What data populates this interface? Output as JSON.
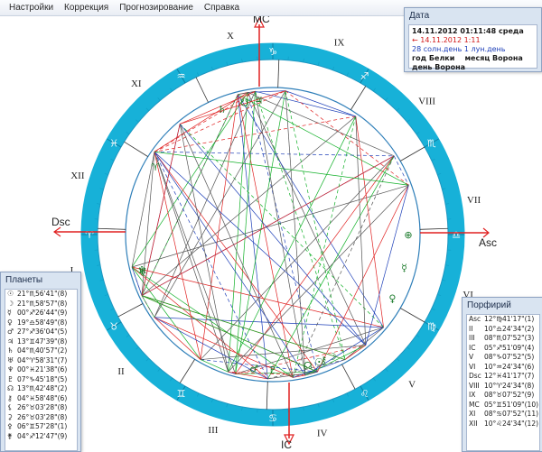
{
  "menu": [
    "Настройки",
    "Коррекция",
    "Прогнозирование",
    "Справка"
  ],
  "chart": {
    "angles": {
      "mc": "MC",
      "ic": "IC",
      "asc": "Asc",
      "dsc": "Dsc"
    },
    "house_numerals": [
      "I",
      "II",
      "III",
      "IV",
      "V",
      "VI",
      "VII",
      "VIII",
      "IX",
      "X",
      "XI",
      "XII"
    ],
    "colors": {
      "ring": "#17b1d8",
      "axis": "#e02020",
      "inner_ring": "#2f7fb9",
      "aspect_green": "#11b028",
      "aspect_red": "#e02020",
      "aspect_blue": "#1d3fb8",
      "aspect_gray": "#555555"
    }
  },
  "date_panel": {
    "title": "Дата",
    "line1": "14.11.2012  01:11:48  среда",
    "line2": "← 14.11.2012  1:11",
    "line3": "28 солн.день 1 лун.день",
    "line4a": "год Белки",
    "line4b": "месяц Ворона",
    "line5": "день Ворона"
  },
  "planets_panel": {
    "title": "Планеты",
    "rows": [
      {
        "glyph": "☉",
        "value": "21°♏56'41\"(8)"
      },
      {
        "glyph": "☽",
        "value": "21°♏58'57\"(8)"
      },
      {
        "glyph": "☿",
        "value": "00°♐26'44\"(9)"
      },
      {
        "glyph": "♀",
        "value": "19°♎58'49\"(8)"
      },
      {
        "glyph": "♂",
        "value": "27°♐36'04\"(5)"
      },
      {
        "glyph": "♃",
        "value": "13°♊47'39\"(8)"
      },
      {
        "glyph": "♄",
        "value": "04°♏40'57\"(2)"
      },
      {
        "glyph": "♅",
        "value": "04°♈58'31\"(7)"
      },
      {
        "glyph": "♆",
        "value": "00°♓21'38\"(6)"
      },
      {
        "glyph": "♇",
        "value": "07°♑45'18\"(5)"
      },
      {
        "glyph": "☊",
        "value": "13°♏42'48\"(2)"
      },
      {
        "glyph": "⚷",
        "value": "04°♓58'48\"(6)"
      },
      {
        "glyph": "⚸",
        "value": "26°♉03'28\"(8)"
      },
      {
        "glyph": "⚳",
        "value": "26°♉03'28\"(8)"
      },
      {
        "glyph": "⚴",
        "value": "06°♊57'28\"(1)"
      },
      {
        "glyph": "⚵",
        "value": "04°♐12'47\"(9)"
      }
    ]
  },
  "houses_panel": {
    "title": "Порфирий",
    "rows": [
      {
        "name": "Asc",
        "value": "12°♍41'17\"(1)"
      },
      {
        "name": "II",
        "value": "10°♎24'34\"(2)"
      },
      {
        "name": "III",
        "value": "08°♏07'52\"(3)"
      },
      {
        "name": "IC",
        "value": "05°♐51'09\"(4)"
      },
      {
        "name": "V",
        "value": "08°♑07'52\"(5)"
      },
      {
        "name": "VI",
        "value": "10°♒24'34\"(6)"
      },
      {
        "name": "Dsc",
        "value": "12°♓41'17\"(7)"
      },
      {
        "name": "VIII",
        "value": "10°♈24'34\"(8)"
      },
      {
        "name": "IX",
        "value": "08°♉07'52\"(9)"
      },
      {
        "name": "MC",
        "value": "05°♊51'09\"(10)"
      },
      {
        "name": "XI",
        "value": "08°♋07'52\"(11)"
      },
      {
        "name": "XII",
        "value": "10°♌24'34\"(12)"
      }
    ]
  }
}
